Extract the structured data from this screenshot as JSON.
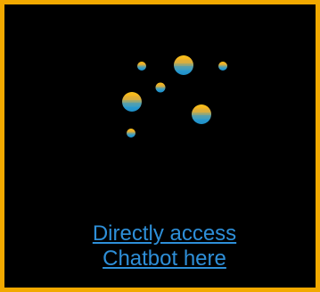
{
  "logo": {
    "icon": "bubbles-logo-icon",
    "colors": {
      "top": "#F5B51F",
      "bottom": "#2A9AD0"
    }
  },
  "link": {
    "line1": "Directly access ",
    "line2": "Chatbot here"
  },
  "colors": {
    "border": "#F2A900",
    "background": "#000000",
    "link": "#2E8FD8"
  }
}
